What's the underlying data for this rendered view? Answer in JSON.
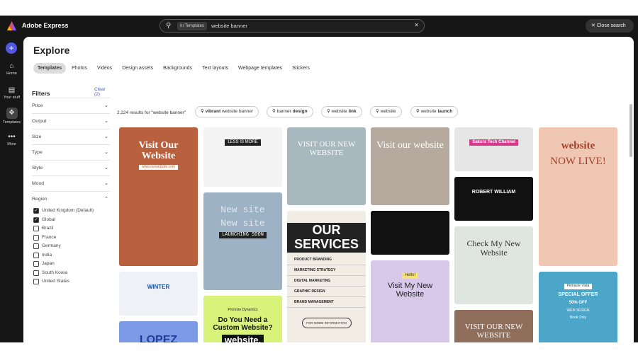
{
  "app": {
    "name": "Adobe Express",
    "close_search": "Close search"
  },
  "search": {
    "scope": "In Templates",
    "value": "website banner"
  },
  "rail": [
    {
      "label": "Home",
      "icon": "home-icon"
    },
    {
      "label": "Your stuff",
      "icon": "folder-icon"
    },
    {
      "label": "Templates",
      "icon": "templates-icon"
    },
    {
      "label": "More",
      "icon": "more-icon"
    }
  ],
  "page": {
    "title": "Explore"
  },
  "tabs": [
    "Templates",
    "Photos",
    "Videos",
    "Design assets",
    "Backgrounds",
    "Text layouts",
    "Webpage templates",
    "Stickers"
  ],
  "filters": {
    "title": "Filters",
    "clear": "Clear (2)",
    "groups": [
      "Price",
      "Output",
      "Size",
      "Type",
      "Style",
      "Mood",
      "Region"
    ],
    "regions": [
      {
        "label": "United Kingdom (Default)",
        "checked": true
      },
      {
        "label": "Global",
        "checked": true
      },
      {
        "label": "Brazil",
        "checked": false
      },
      {
        "label": "France",
        "checked": false
      },
      {
        "label": "Germany",
        "checked": false
      },
      {
        "label": "India",
        "checked": false
      },
      {
        "label": "Japan",
        "checked": false
      },
      {
        "label": "South Korea",
        "checked": false
      },
      {
        "label": "United States",
        "checked": false
      }
    ]
  },
  "results": {
    "count": "2,224 results for \"website banner\""
  },
  "suggestions": [
    {
      "pre": "",
      "bold": "vibrant",
      "post": " website banner"
    },
    {
      "pre": "banner ",
      "bold": "design",
      "post": ""
    },
    {
      "pre": "website ",
      "bold": "link",
      "post": ""
    },
    {
      "pre": "website",
      "bold": "",
      "post": ""
    },
    {
      "pre": "website ",
      "bold": "launch",
      "post": ""
    }
  ],
  "cards": {
    "c1": "Visit Our Website",
    "c1b": "www.ourwebsite.com",
    "c2": "WINTER",
    "c3": "LOPEZ",
    "c4": "LESS IS MORE",
    "c5": "New site",
    "c5b": "LAUNCHING SOON",
    "c6a": "Promote Dynamics",
    "c6": "Do You Need a Custom Website?",
    "c6b": "website.",
    "c7": "VISIT OUR NEW WEBSITE",
    "c8": "OUR SERVICES",
    "c8list": [
      "PRODUCT BRANDING",
      "MARKETING STRATEGY",
      "DIGITAL MARKETING",
      "GRAPHIC DESIGN",
      "BRAND MANAGEMENT"
    ],
    "c8b": "FOR MORE INFORMATION",
    "c9": "Visit our website",
    "c10": "Hello!",
    "c10b": "Visit My New Website",
    "c11": "Sakura Tech Channel",
    "c12": "ROBERT WILLIAM",
    "c13": "Check My New Website",
    "c14": "VISIT OUR NEW WEBSITE",
    "c15": "website",
    "c15b": "NOW LIVE!",
    "c16": "Pinnacle Vista",
    "c16b": "SPECIAL OFFER",
    "c16c": "50% OFF",
    "c16d": "WEB DESIGN",
    "c16e": "Book Only"
  }
}
